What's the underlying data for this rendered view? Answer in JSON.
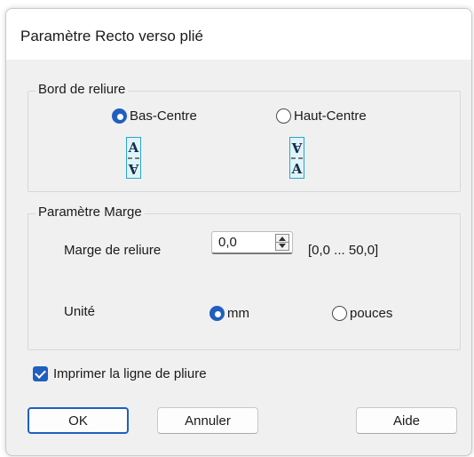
{
  "dialog": {
    "title": "Paramètre Recto verso plié"
  },
  "binding_edge": {
    "legend": "Bord de reliure",
    "options": [
      {
        "label": "Bas-Centre",
        "selected": true,
        "icon": "fold-bottom-center-icon"
      },
      {
        "label": "Haut-Centre",
        "selected": false,
        "icon": "fold-top-center-icon"
      }
    ],
    "icon_letter": "A"
  },
  "margin": {
    "legend": "Paramètre Marge",
    "binding_margin_label": "Marge de reliure",
    "binding_margin_value": "0,0",
    "range_text": "[0,0 ... 50,0]",
    "unit_label": "Unité",
    "units": [
      {
        "label": "mm",
        "selected": true
      },
      {
        "label": "pouces",
        "selected": false
      }
    ]
  },
  "print_fold_line": {
    "label": "Imprimer la ligne de pliure",
    "checked": true
  },
  "buttons": {
    "ok": "OK",
    "cancel": "Annuler",
    "help": "Aide"
  },
  "colors": {
    "accent": "#1f5fbf",
    "icon_border": "#2aa6c4",
    "dialog_bg": "#f0f0f0"
  }
}
